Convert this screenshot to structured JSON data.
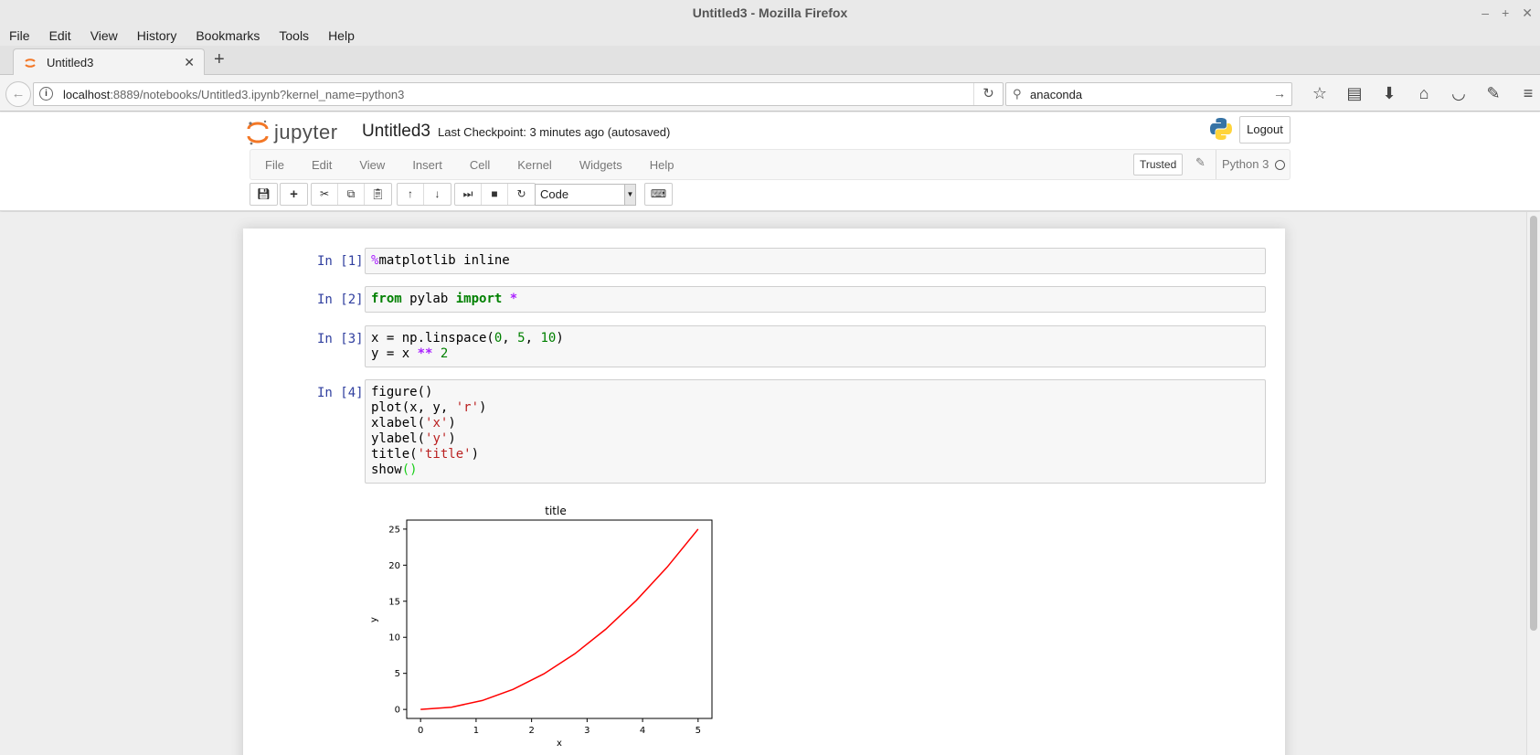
{
  "window": {
    "title": "Untitled3 - Mozilla Firefox"
  },
  "browser_menu": [
    "File",
    "Edit",
    "View",
    "History",
    "Bookmarks",
    "Tools",
    "Help"
  ],
  "tab": {
    "title": "Untitled3"
  },
  "address": {
    "host": "localhost",
    "rest": ":8889/notebooks/Untitled3.ipynb?kernel_name=python3"
  },
  "search": {
    "value": "anaconda"
  },
  "jupyter": {
    "logo_text": "jupyter",
    "notebook_name": "Untitled3",
    "checkpoint": "Last Checkpoint: 3 minutes ago (autosaved)",
    "logout": "Logout",
    "menu": [
      "File",
      "Edit",
      "View",
      "Insert",
      "Cell",
      "Kernel",
      "Widgets",
      "Help"
    ],
    "trusted": "Trusted",
    "kernel": "Python 3",
    "cell_type": "Code"
  },
  "cells": [
    {
      "prompt": "In [1]:"
    },
    {
      "prompt": "In [2]:"
    },
    {
      "prompt": "In [3]:"
    },
    {
      "prompt": "In [4]:"
    }
  ],
  "code": {
    "c1_magic": "%",
    "c1_rest": "matplotlib inline",
    "c2_from": "from",
    "c2_mod": " pylab ",
    "c2_import": "import",
    "c2_star": " *",
    "c3_l1a": "x = np.linspace(",
    "c3_l1b": "0",
    "c3_l1c": ", ",
    "c3_l1d": "5",
    "c3_l1e": ", ",
    "c3_l1f": "10",
    "c3_l1g": ")",
    "c3_l2a": "y = x ",
    "c3_l2b": "**",
    "c3_l2c": " ",
    "c3_l2d": "2",
    "c4_l1": "figure()",
    "c4_l2a": "plot(x, y, ",
    "c4_l2b": "'r'",
    "c4_l2c": ")",
    "c4_l3a": "xlabel(",
    "c4_l3b": "'x'",
    "c4_l3c": ")",
    "c4_l4a": "ylabel(",
    "c4_l4b": "'y'",
    "c4_l4c": ")",
    "c4_l5a": "title(",
    "c4_l5b": "'title'",
    "c4_l5c": ")",
    "c4_l6a": "show",
    "c4_l6b": "()"
  },
  "chart_data": {
    "type": "line",
    "title": "title",
    "xlabel": "x",
    "ylabel": "y",
    "xlim": [
      -0.25,
      5.25
    ],
    "ylim": [
      -1.25,
      26.25
    ],
    "xticks": [
      0,
      1,
      2,
      3,
      4,
      5
    ],
    "yticks": [
      0,
      5,
      10,
      15,
      20,
      25
    ],
    "grid": false,
    "series": [
      {
        "color": "#ff0000",
        "x": [
          0,
          0.5556,
          1.1111,
          1.6667,
          2.2222,
          2.7778,
          3.3333,
          3.8889,
          4.4444,
          5
        ],
        "y": [
          0,
          0.3086,
          1.2346,
          2.7778,
          4.9383,
          7.716,
          11.1111,
          15.1235,
          19.7531,
          25
        ]
      }
    ]
  }
}
